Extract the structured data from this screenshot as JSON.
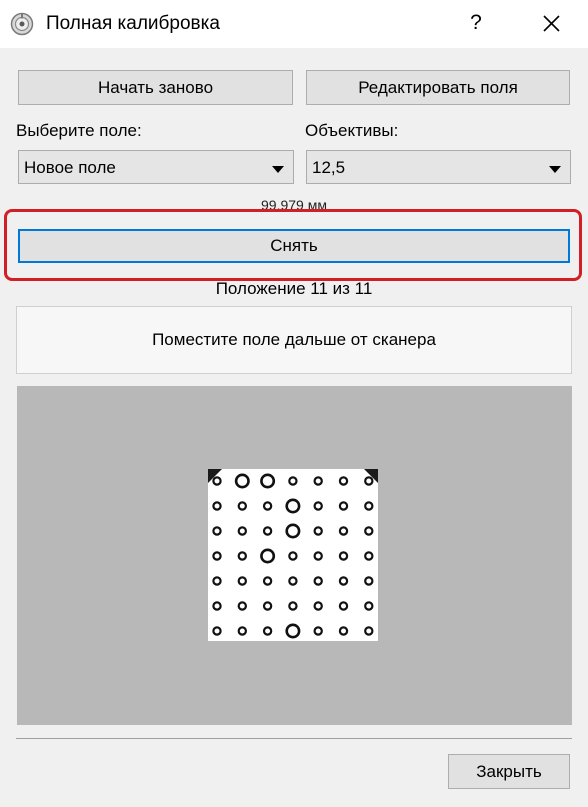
{
  "window": {
    "title": "Полная калибровка",
    "help_label": "?"
  },
  "toolbar": {
    "restart_label": "Начать заново",
    "edit_fields_label": "Редактировать поля"
  },
  "field_select": {
    "label": "Выберите поле:",
    "value": "Новое поле"
  },
  "lens_select": {
    "label": "Объективы:",
    "value": "12,5"
  },
  "measurement": "99,979 мм",
  "capture_button": "Снять",
  "position_text": "Положение 11 из 11",
  "instruction": "Поместите поле дальше от сканера",
  "footer": {
    "close_label": "Закрыть"
  },
  "colors": {
    "highlight": "#d21f26",
    "focus": "#0078d7",
    "preview_background": "#b8b8b8"
  },
  "icons": [
    "app-icon",
    "close-icon",
    "dropdown-arrow-icon",
    "calibration-target-image"
  ]
}
